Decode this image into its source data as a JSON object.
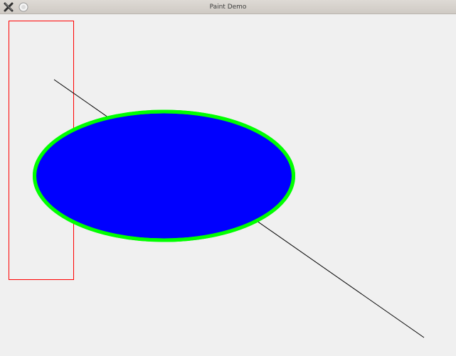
{
  "window": {
    "title": "Paint Demo",
    "controls": {
      "close_icon": "close-x-icon",
      "minimize_icon": "minimize-circle-icon"
    }
  },
  "canvas": {
    "background": "#f0f0f0",
    "shapes": {
      "rectangle": {
        "stroke": "#ff0000",
        "fill": "none"
      },
      "line": {
        "stroke": "#000000"
      },
      "ellipse": {
        "fill": "#0000ff",
        "stroke": "#00ff00"
      }
    }
  }
}
